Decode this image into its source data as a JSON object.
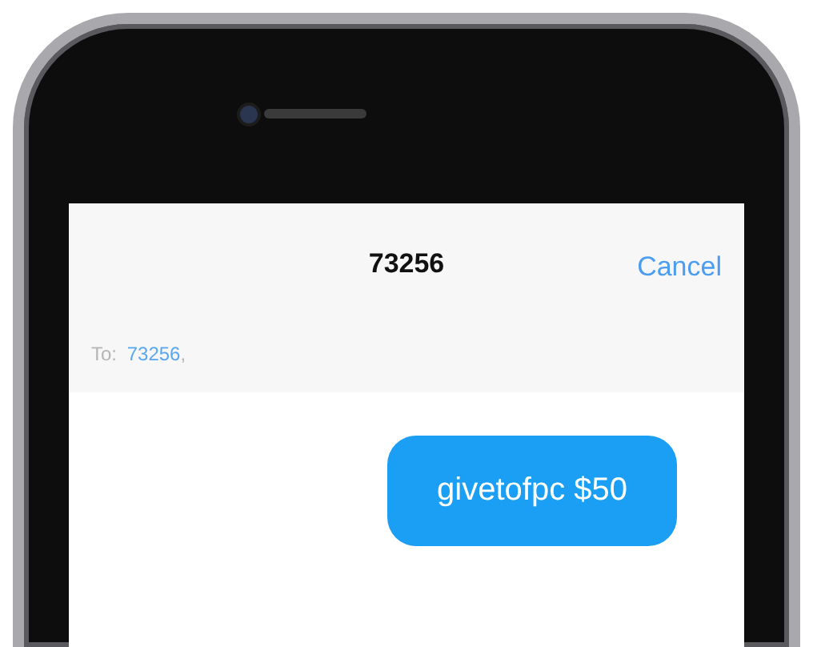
{
  "header": {
    "title": "73256",
    "cancel": "Cancel"
  },
  "recipients": {
    "label": "To:",
    "entries": [
      {
        "name": "73256",
        "separator": ","
      }
    ]
  },
  "messages": [
    {
      "text": "givetofpc $50",
      "kind": "outgoing"
    }
  ]
}
